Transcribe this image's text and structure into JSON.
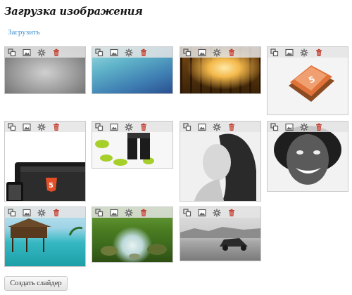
{
  "page": {
    "title": "Загрузка изображения",
    "upload_link": "Загрузить",
    "create_slider_button": "Создать слайдер"
  },
  "toolbar_icons": [
    "crop-icon",
    "image-icon",
    "settings-icon",
    "trash-icon"
  ],
  "colors": {
    "link": "#3a8fcf",
    "trash": "#c0392b",
    "card_border": "#c9c9c9",
    "toolbar_bg": "#e4e4e4"
  },
  "images": [
    {
      "name": "gray-gradient"
    },
    {
      "name": "blue-teal-gradient"
    },
    {
      "name": "sunlit-forest"
    },
    {
      "name": "html5-logo-3d"
    },
    {
      "name": "tablet-html5"
    },
    {
      "name": "green-cloud-boxes"
    },
    {
      "name": "woman-hair-portrait"
    },
    {
      "name": "smiling-woman-portrait"
    },
    {
      "name": "tropical-bungalow"
    },
    {
      "name": "forest-stream"
    },
    {
      "name": "vintage-car-bw"
    }
  ]
}
